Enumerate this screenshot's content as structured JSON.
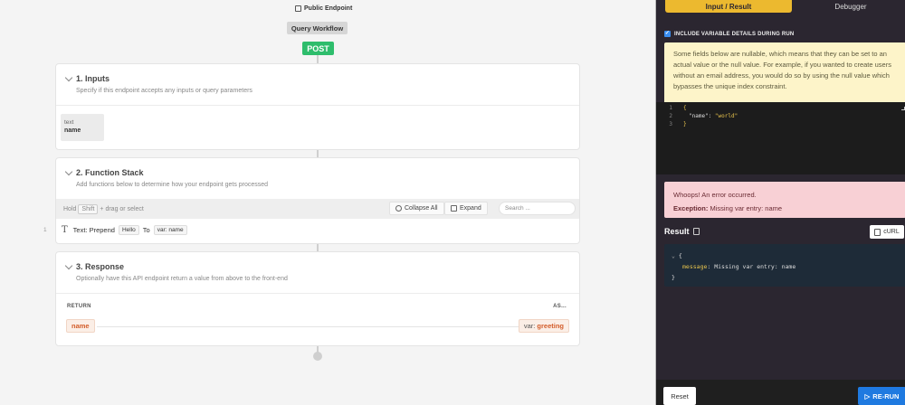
{
  "header": {
    "public_endpoint": "Public Endpoint",
    "query_workflow": "Query Workflow",
    "method": "POST"
  },
  "inputs": {
    "title": "1. Inputs",
    "subtitle": "Specify if this endpoint accepts any inputs or query parameters",
    "chip_type": "text",
    "chip_name": "name"
  },
  "function_stack": {
    "title": "2. Function Stack",
    "subtitle": "Add functions below to determine how your endpoint gets processed",
    "hold": "Hold",
    "shift": "Shift",
    "drag_hint": "+ drag or select",
    "collapse_all": "Collapse All",
    "expand": "Expand",
    "search_placeholder": "Search ...",
    "row_number": "1",
    "row_label": "Text: Prepend",
    "row_value": "Hello",
    "row_to": "To",
    "row_var": "var: name"
  },
  "response": {
    "title": "3. Response",
    "subtitle": "Optionally have this API endpoint return a value from above to the front-end",
    "return_label": "RETURN",
    "as_label": "AS...",
    "return_value": "name",
    "as_prefix": "var:",
    "as_value": "greeting"
  },
  "panel": {
    "tab_input_result": "Input / Result",
    "tab_debugger": "Debugger",
    "include_label": "INCLUDE VARIABLE DETAILS DURING RUN",
    "include_checked": true,
    "info_text": "Some fields below are nullable, which means that they can be set to an actual value or the null value. For example, if you wanted to create users without an email address, you would do so by using the null value which bypasses the unique index constraint.",
    "editor_lines": [
      {
        "num": "1",
        "text": "{"
      },
      {
        "num": "2",
        "key": "\"name\"",
        "sep": ": ",
        "str": "\"world\""
      },
      {
        "num": "3",
        "text": "}"
      }
    ],
    "error_title": "Whoops! An error occurred.",
    "error_label": "Exception:",
    "error_message": "Missing var entry: name",
    "result_label": "Result",
    "curl_label": "cURL",
    "result_open": "{",
    "result_key": "message",
    "result_value": ": Missing var entry: name",
    "result_close": "}",
    "reset_label": "Reset",
    "rerun_label": "RE-RUN"
  },
  "colors": {
    "post": "#2ebd6c",
    "tab_active": "#ecb92f",
    "rerun": "#1f7ae0",
    "error_bg": "#f8d0d5",
    "info_bg": "#fdf4c9"
  }
}
